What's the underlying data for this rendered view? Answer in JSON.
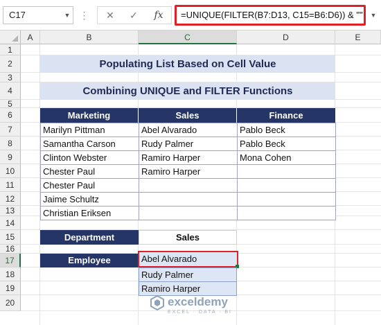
{
  "name_box": "C17",
  "formula_bar": {
    "cancel_icon": "✕",
    "enter_icon": "✓",
    "fx_label": "fx",
    "formula": "=UNIQUE(FILTER(B7:D13, C15=B6:D6)) & \"\""
  },
  "columns": [
    "A",
    "B",
    "C",
    "D",
    "E"
  ],
  "rows": [
    "1",
    "2",
    "3",
    "4",
    "5",
    "6",
    "7",
    "8",
    "9",
    "10",
    "11",
    "12",
    "13",
    "14",
    "15",
    "16",
    "17",
    "18",
    "19",
    "20"
  ],
  "title1": "Populating List Based on Cell Value",
  "title2": "Combining UNIQUE and FILTER Functions",
  "table": {
    "headers": [
      "Marketing",
      "Sales",
      "Finance"
    ],
    "rows": [
      [
        "Marilyn Pittman",
        "Abel Alvarado",
        "Pablo Beck"
      ],
      [
        "Samantha Carson",
        "Rudy Palmer",
        "Pablo Beck"
      ],
      [
        "Clinton Webster",
        "Ramiro Harper",
        "Mona Cohen"
      ],
      [
        "Chester Paul",
        "Ramiro Harper",
        ""
      ],
      [
        "Chester Paul",
        "",
        ""
      ],
      [
        "Jaime Schultz",
        "",
        ""
      ],
      [
        "Christian Eriksen",
        "",
        ""
      ]
    ]
  },
  "department": {
    "label": "Department",
    "value": "Sales"
  },
  "employee": {
    "label": "Employee",
    "selected": "Abel Alvarado",
    "dropdown": [
      "Rudy Palmer",
      "Ramiro Harper"
    ]
  },
  "watermark": {
    "name": "exceldemy",
    "tagline": "EXCEL · DATA · BI"
  },
  "colors": {
    "accent_red": "#e01f26",
    "header_navy": "#243566",
    "banner_blue": "#dbe3f2",
    "excel_green": "#217346"
  }
}
